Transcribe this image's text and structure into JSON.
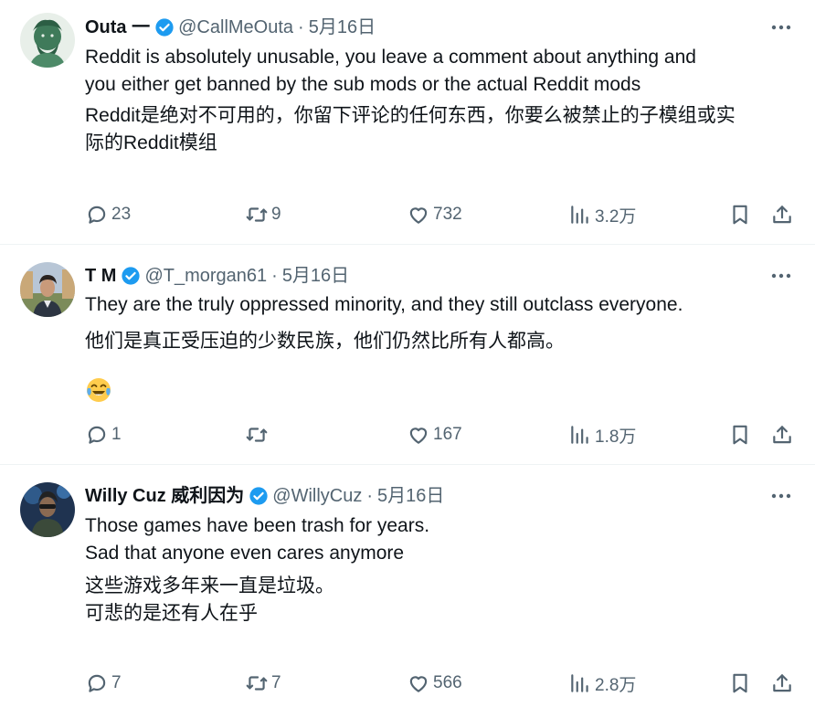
{
  "tweets": [
    {
      "name": "Outa 一",
      "handle": "@CallMeOuta",
      "separator": "·",
      "time": "5月16日",
      "text": "Reddit is absolutely unusable, you leave a comment about anything and\nyou either get banned by the sub mods or the actual Reddit mods",
      "translation": "Reddit是绝对不可用的，你留下评论的任何东西，你要么被禁止的子模组或实\n际的Reddit模组",
      "replies": "23",
      "retweets": "9",
      "likes": "732",
      "views": "3.2万"
    },
    {
      "name": "T M",
      "handle": "@T_morgan61",
      "separator": "·",
      "time": "5月16日",
      "text": "They are the truly oppressed minority, and they still outclass everyone.",
      "translation": "他们是真正受压迫的少数民族，他们仍然比所有人都高。",
      "replies": "1",
      "retweets": "",
      "likes": "167",
      "views": "1.8万"
    },
    {
      "name": "Willy Cuz 威利因为",
      "handle": "@WillyCuz",
      "separator": "·",
      "time": "5月16日",
      "text": "Those games have been trash for years.\nSad that anyone even cares anymore",
      "translation": "这些游戏多年来一直是垃圾。\n可悲的是还有人在乎",
      "replies": "7",
      "retweets": "7",
      "likes": "566",
      "views": "2.8万"
    }
  ],
  "icons": {
    "verified": "verified-badge-icon",
    "more": "more-options-icon",
    "reply": "reply-icon",
    "retweet": "retweet-icon",
    "like": "like-icon",
    "views": "views-icon",
    "bookmark": "bookmark-icon",
    "share": "share-icon",
    "emoji": "laughing-tears-emoji"
  },
  "colors": {
    "text": "#0f1419",
    "muted": "#536471",
    "verified": "#1d9bf0",
    "divider": "#eff3f4"
  }
}
